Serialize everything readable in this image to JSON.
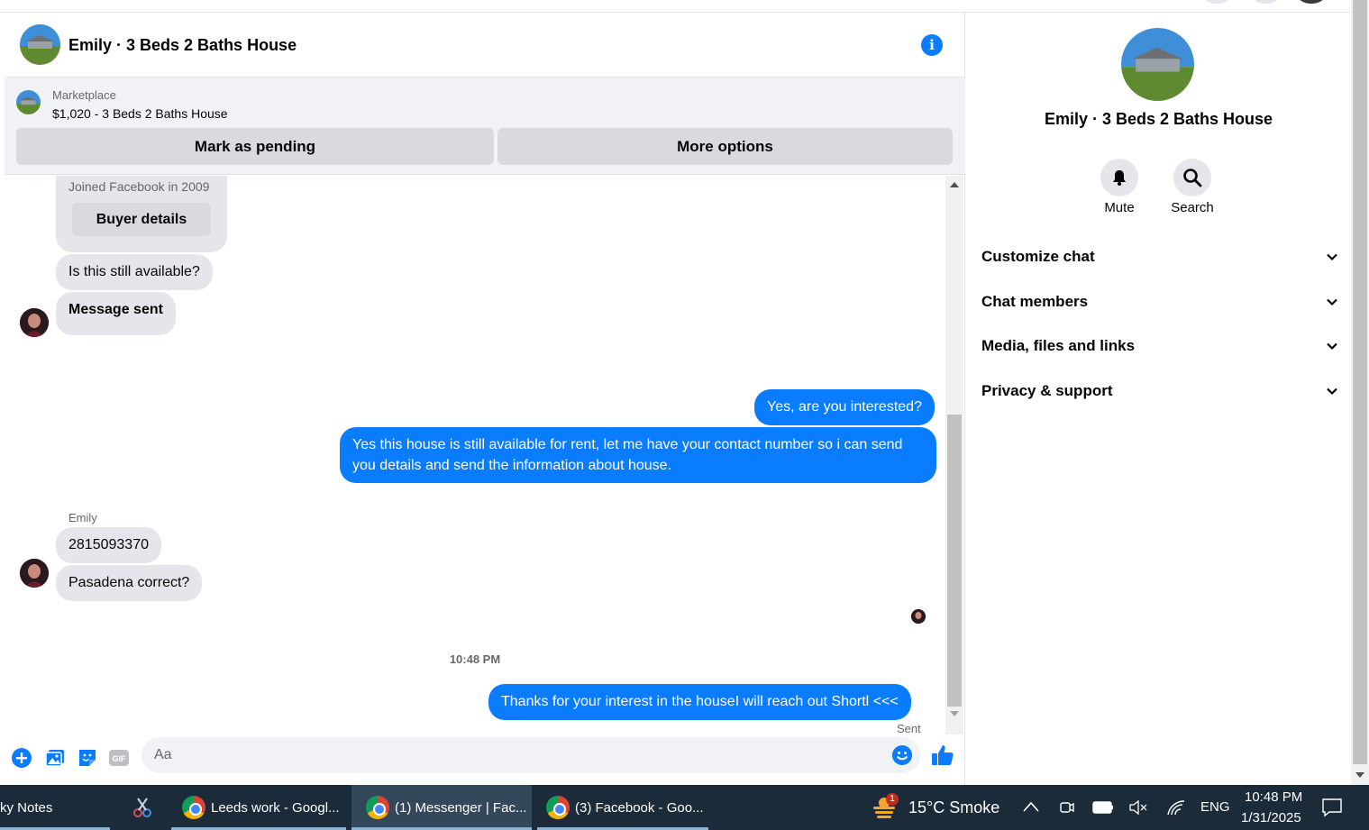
{
  "chat": {
    "title": "Emily · 3 Beds 2 Baths House",
    "marketplace_label": "Marketplace",
    "listing": "$1,020 - 3 Beds 2 Baths House",
    "mark_pending": "Mark as pending",
    "more_options": "More options"
  },
  "messages": {
    "joined": "Joined Facebook in 2009",
    "buyer_details": "Buyer details",
    "m1": "Is this still available?",
    "m2": "Message sent",
    "m3": "Yes, are you interested?",
    "m4": "Yes this house is still available for rent, let me have your contact number so i can send you details and send the information about house.",
    "sender": "Emily",
    "m5": "2815093370",
    "m6": "Pasadena correct?",
    "time": "10:48 PM",
    "m7": "Thanks for your interest in the houseI will reach out Shortl <<<",
    "sent": "Sent"
  },
  "composer": {
    "placeholder": "Aa"
  },
  "side": {
    "title": "Emily · 3 Beds 2 Baths House",
    "mute": "Mute",
    "search": "Search",
    "sections": [
      "Customize chat",
      "Chat members",
      "Media, files and links",
      "Privacy & support"
    ]
  },
  "taskbar": {
    "sticky": "ky Notes",
    "leeds": "Leeds work - Googl...",
    "messenger": "(1) Messenger | Fac...",
    "facebook": "(3) Facebook - Goo...",
    "weather": "15°C Smoke",
    "weather_badge": "1",
    "lang": "ENG",
    "time": "10:48 PM",
    "date": "1/31/2025"
  },
  "colors": {
    "messenger_blue": "#0a7cff",
    "bubble_gray": "#e4e6eb",
    "taskbar": "#1c2b3a"
  }
}
